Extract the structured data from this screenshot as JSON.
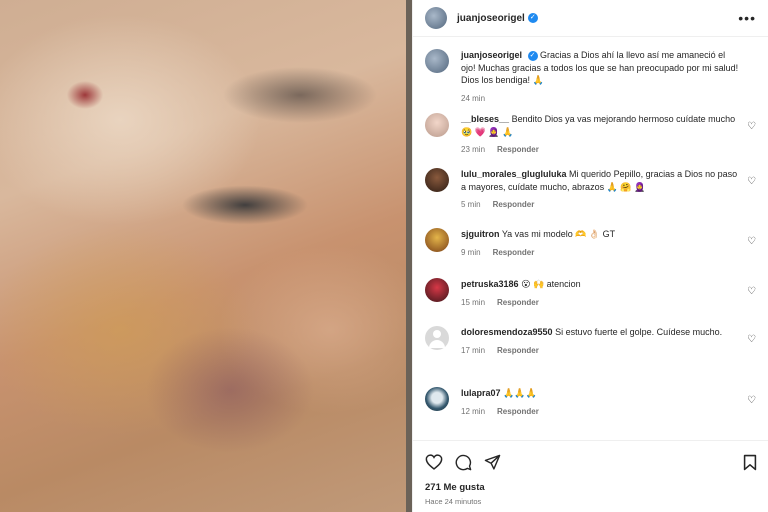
{
  "post": {
    "username": "juanjoseorigel",
    "verified_icon": "verified-badge-icon",
    "more_icon": "more-options-icon"
  },
  "caption": {
    "username": "juanjoseorigel",
    "text": "Gracias a Dios ahí la llevo así me amaneció el ojo! Muchas gracias a todos los que se han preocupado por mi salud! Dios los bendiga! 🙏",
    "time": "24 min"
  },
  "comments": [
    {
      "username": "__bleses__",
      "text": "Bendito Dios ya vas mejorando hermoso cuídate mucho 🥹 💗 🧕 🙏",
      "time": "23 min",
      "reply": "Responder"
    },
    {
      "username": "lulu_morales_glugluluka",
      "text": "Mi querido Pepillo, gracias a Dios no paso a mayores, cuídate mucho, abrazos 🙏 🤗 🧕",
      "time": "5 min",
      "reply": "Responder"
    },
    {
      "username": "sjguitron",
      "text": "Ya vas mi modelo 🫶 👌🏻 GT",
      "time": "9 min",
      "reply": "Responder"
    },
    {
      "username": "petruska3186",
      "text": "😮 🙌 atencion",
      "time": "15 min",
      "reply": "Responder"
    },
    {
      "username": "doloresmendoza9550",
      "text": "Si estuvo fuerte el golpe. Cuídese mucho.",
      "time": "17 min",
      "reply": "Responder"
    },
    {
      "username": "lulapra07",
      "text": "🙏🙏🙏",
      "time": "12 min",
      "reply": "Responder"
    }
  ],
  "actions": {
    "likes": "271 Me gusta",
    "ago": "Hace 24 minutos"
  }
}
